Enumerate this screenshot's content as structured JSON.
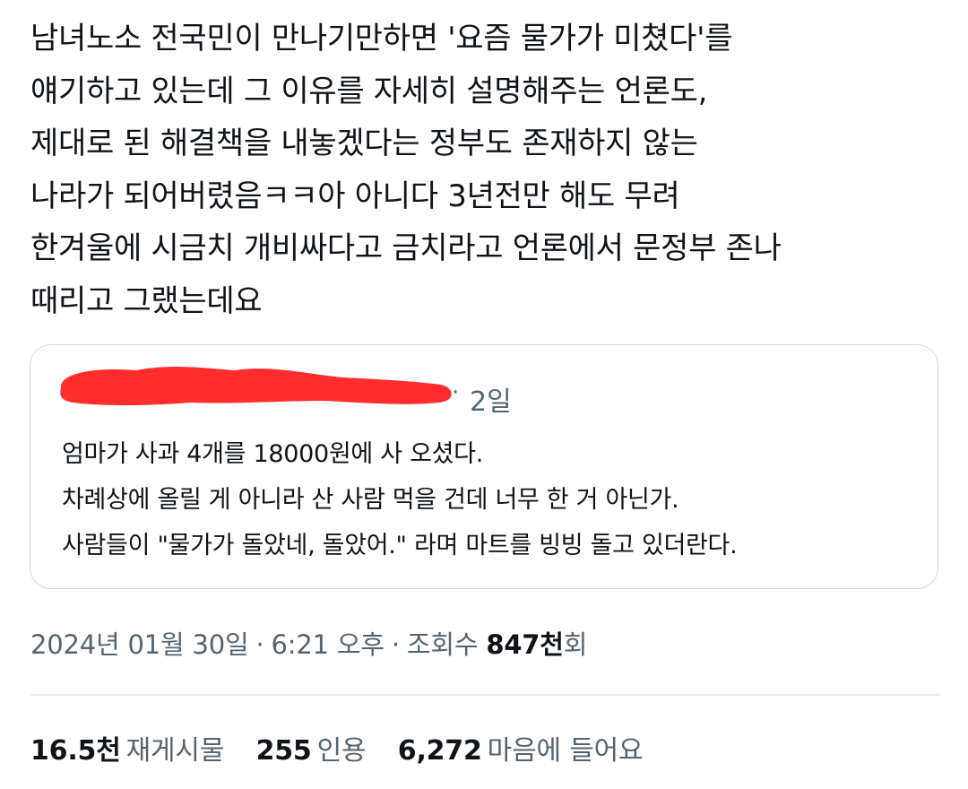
{
  "tweet": {
    "lines": [
      "남녀노소 전국민이 만나기만하면 '요즘 물가가 미쳤다'를",
      "얘기하고 있는데 그 이유를 자세히 설명해주는 언론도,",
      "제대로 된 해결책을 내놓겠다는 정부도 존재하지 않는",
      "나라가 되어버렸음ㅋㅋ아 아니다 3년전만 해도 무려",
      "한겨울에 시금치 개비싸다고 금치라고 언론에서 문정부 존나",
      "때리고 그랬는데요"
    ]
  },
  "quote": {
    "separator": "·",
    "time": "2일",
    "lines": [
      "엄마가 사과 4개를 18000원에 사 오셨다.",
      "차례상에 올릴 게 아니라 산 사람 먹을 건데 너무 한 거 아닌가.",
      "사람들이 \"물가가 돌았네, 돌았어.\" 라며 마트를 빙빙 돌고 있더란다."
    ]
  },
  "meta": {
    "date": "2024년 01월 30일",
    "sep1": "·",
    "time": "6:21 오후",
    "sep2": "·",
    "views_label": "조회수",
    "views_count": "847천",
    "views_suffix": "회"
  },
  "stats": {
    "reposts_value": "16.5천",
    "reposts_label": "재게시물",
    "quotes_value": "255",
    "quotes_label": "인용",
    "likes_value": "6,272",
    "likes_label": "마음에 들어요"
  },
  "colors": {
    "text_primary": "#0f1419",
    "text_secondary": "#536471",
    "border": "#cfd9de",
    "redaction": "#ff2d2d"
  }
}
